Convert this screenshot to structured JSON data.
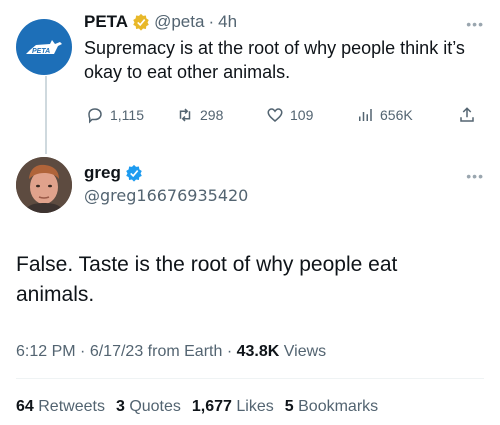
{
  "parent_tweet": {
    "name": "PETA",
    "handle": "@peta",
    "separator": "·",
    "time": "4h",
    "text": "Supremacy is at the root of why people think it’s okay to eat other animals.",
    "avatar_text": "PETA",
    "more_icon": "ellipsis-icon",
    "badge_color": "#e8b829",
    "actions": {
      "replies": "1,115",
      "retweets": "298",
      "likes": "109",
      "views": "656K"
    }
  },
  "main_tweet": {
    "name": "greg",
    "handle": "@greg16676935420",
    "badge_color": "#1d9bf0",
    "text": "False. Taste is the root of why people eat animals.",
    "meta": {
      "time": "6:12 PM",
      "sep1": "·",
      "date": "6/17/23",
      "location": "from Earth",
      "sep2": "·",
      "views_count": "43.8K",
      "views_label": "Views"
    },
    "stats": {
      "retweets_count": "64",
      "retweets_label": "Retweets",
      "quotes_count": "3",
      "quotes_label": "Quotes",
      "likes_count": "1,677",
      "likes_label": "Likes",
      "bookmarks_count": "5",
      "bookmarks_label": "Bookmarks"
    }
  }
}
